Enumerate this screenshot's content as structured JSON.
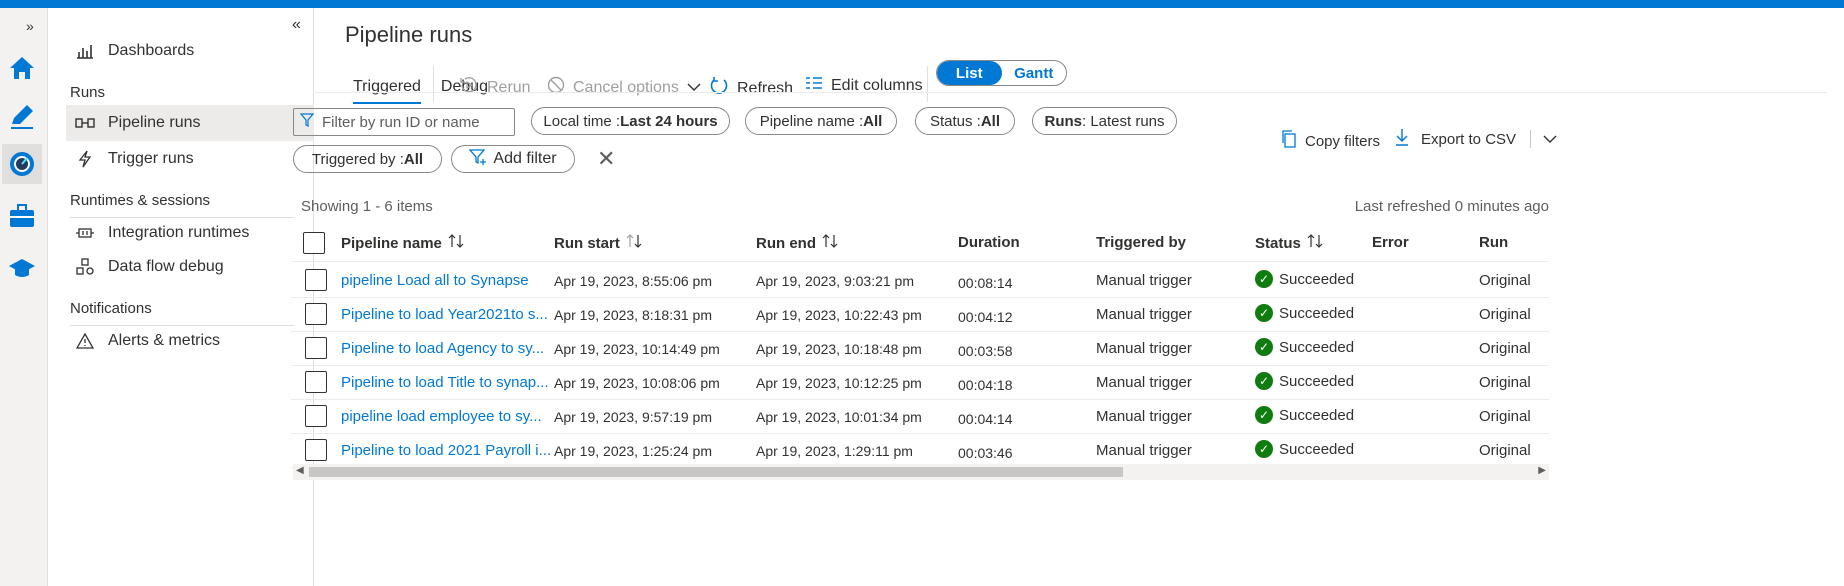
{
  "rail": {
    "expand_label": "»"
  },
  "nav": {
    "collapse_label": "«",
    "items": [
      {
        "label": "Dashboards"
      },
      {
        "label": "Pipeline runs"
      },
      {
        "label": "Trigger runs"
      },
      {
        "label": "Integration runtimes"
      },
      {
        "label": "Data flow debug"
      },
      {
        "label": "Alerts & metrics"
      }
    ],
    "sections": [
      "Runs",
      "Runtimes & sessions",
      "Notifications"
    ]
  },
  "page": {
    "title": "Pipeline runs"
  },
  "tabs": [
    "Triggered",
    "Debug"
  ],
  "toolbar": {
    "rerun": "Rerun",
    "cancel_options": "Cancel options",
    "refresh": "Refresh",
    "edit_columns": "Edit columns",
    "view_list": "List",
    "view_gantt": "Gantt"
  },
  "filters": {
    "search_placeholder": "Filter by run ID or name",
    "local_time_label": "Local time : ",
    "local_time_value": "Last 24 hours",
    "pipeline_name_label": "Pipeline name : ",
    "pipeline_name_value": "All",
    "status_label": "Status : ",
    "status_value": "All",
    "runs_label": "Runs",
    "runs_value": " : Latest runs",
    "triggered_by_label": "Triggered by : ",
    "triggered_by_value": "All",
    "add_filter": "Add filter",
    "copy_filters": "Copy filters",
    "export_csv": "Export to CSV"
  },
  "summary": {
    "showing": "Showing 1 - 6 items",
    "last_refreshed": "Last refreshed 0 minutes ago"
  },
  "table": {
    "columns": [
      "Pipeline name",
      "Run start",
      "Run end",
      "Duration",
      "Triggered by",
      "Status",
      "Error",
      "Run"
    ],
    "rows": [
      {
        "name": "pipeline Load all to Synapse",
        "start": "Apr 19, 2023, 8:55:06 pm",
        "end": "Apr 19, 2023, 9:03:21 pm",
        "duration": "00:08:14",
        "triggered_by": "Manual trigger",
        "status": "Succeeded",
        "error": "",
        "run": "Original"
      },
      {
        "name": "Pipeline to load Year2021to s...",
        "start": "Apr 19, 2023, 8:18:31 pm",
        "end": "Apr 19, 2023, 10:22:43 pm",
        "duration": "00:04:12",
        "triggered_by": "Manual trigger",
        "status": "Succeeded",
        "error": "",
        "run": "Original"
      },
      {
        "name": "Pipeline to load Agency to sy...",
        "start": "Apr 19, 2023, 10:14:49 pm",
        "end": "Apr 19, 2023, 10:18:48 pm",
        "duration": "00:03:58",
        "triggered_by": "Manual trigger",
        "status": "Succeeded",
        "error": "",
        "run": "Original"
      },
      {
        "name": "Pipeline to load Title to synap...",
        "start": "Apr 19, 2023, 10:08:06 pm",
        "end": "Apr 19, 2023, 10:12:25 pm",
        "duration": "00:04:18",
        "triggered_by": "Manual trigger",
        "status": "Succeeded",
        "error": "",
        "run": "Original"
      },
      {
        "name": "pipeline load employee to sy...",
        "start": "Apr 19, 2023, 9:57:19 pm",
        "end": "Apr 19, 2023, 10:01:34 pm",
        "duration": "00:04:14",
        "triggered_by": "Manual trigger",
        "status": "Succeeded",
        "error": "",
        "run": "Original"
      },
      {
        "name": "Pipeline to load 2021 Payroll i...",
        "start": "Apr 19, 2023, 1:25:24 pm",
        "end": "Apr 19, 2023, 1:29:11 pm",
        "duration": "00:03:46",
        "triggered_by": "Manual trigger",
        "status": "Succeeded",
        "error": "",
        "run": "Original"
      }
    ]
  },
  "colors": {
    "accent": "#0078d4",
    "success": "#107c10"
  }
}
